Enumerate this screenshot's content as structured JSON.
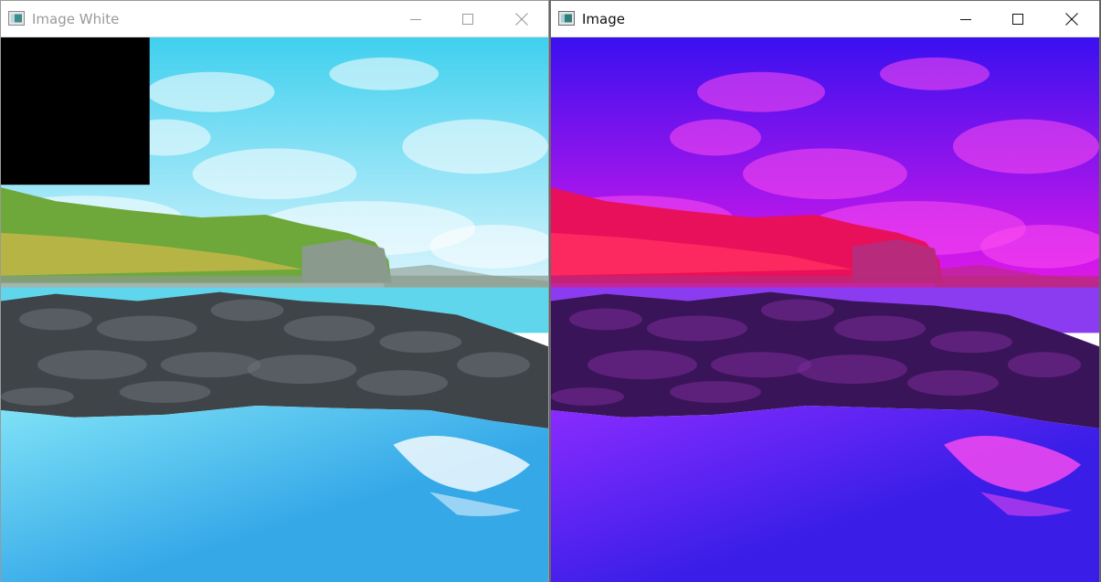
{
  "windows": [
    {
      "title": "Image White",
      "active": false,
      "overlay_color": "#000000",
      "palette": {
        "sky_top": "#3fd0ee",
        "sky_bottom": "#e8f8ff",
        "hill": "#6ea83a",
        "hill_light": "#c9b64a",
        "cliff": "#8a9a8c",
        "rocks": "#3e4448",
        "rocks_light": "#6b7378",
        "sea": "#5fd6ec",
        "water": "#35a8e8",
        "water_light": "#7fe2f6",
        "foam": "#ffffff"
      }
    },
    {
      "title": "Image",
      "active": true,
      "palette": {
        "sky_top": "#3a10f0",
        "sky_bottom": "#f01ae8",
        "hill": "#e8105a",
        "hill_light": "#ff3060",
        "cliff": "#b82a7c",
        "rocks": "#3a1458",
        "rocks_light": "#7a2c9a",
        "sea": "#8c3cf0",
        "water": "#3a1ee8",
        "water_light": "#8a2cff",
        "foam": "#ff4cf0"
      }
    }
  ],
  "controls": {
    "minimize": "minimize-icon",
    "maximize": "maximize-icon",
    "close": "close-icon"
  }
}
